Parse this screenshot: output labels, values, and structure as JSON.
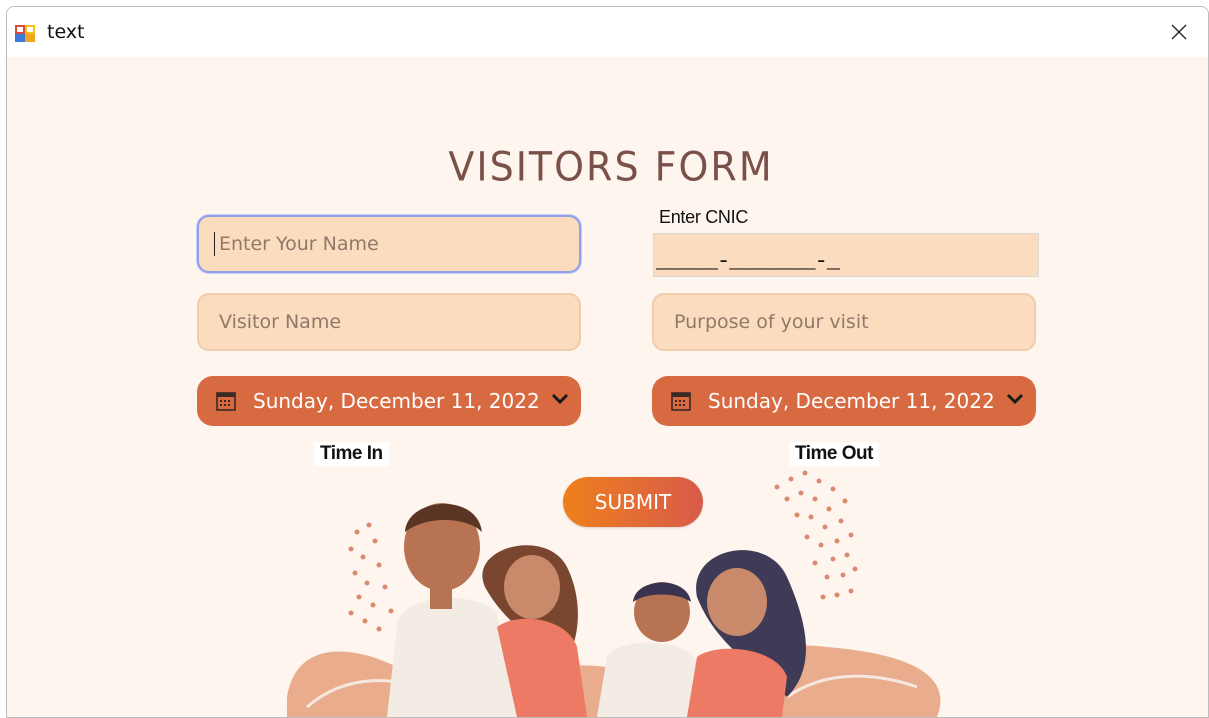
{
  "window": {
    "title": "text"
  },
  "form": {
    "title": "VISITORS FORM",
    "name_placeholder": "Enter Your Name",
    "cnic_label": "Enter CNIC",
    "cnic_mask": "_____-_______-_",
    "visitor_name_placeholder": "Visitor Name",
    "purpose_placeholder": "Purpose of your visit",
    "time_in_date": "Sunday, December 11, 2022",
    "time_out_date": "Sunday, December 11, 2022",
    "time_in_label": "Time In",
    "time_out_label": "Time Out",
    "submit_label": "SUBMIT"
  },
  "icons": {
    "app": "app-icon",
    "close": "close-icon",
    "calendar": "calendar-icon",
    "dropdown": "chevron-down-icon"
  },
  "colors": {
    "background": "#fdf5ee",
    "title": "#7a5149",
    "field": "#fcdcbf",
    "date_picker": "#d86a41",
    "submit_start": "#ef7f1c",
    "submit_end": "#d85b4a",
    "focus_border": "#8ea1e8"
  }
}
